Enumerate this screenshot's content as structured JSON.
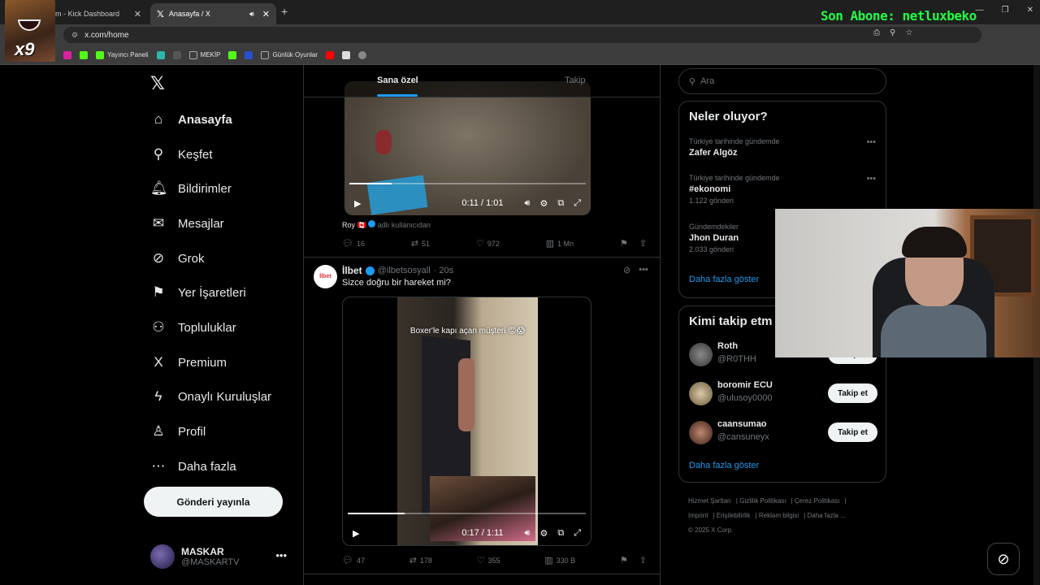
{
  "browser": {
    "tabs": [
      {
        "title": "m - Kick Dashboard",
        "active": false
      },
      {
        "title": "Anasayfa / X",
        "active": true
      }
    ],
    "url": "x.com/home",
    "overlay_text": "Son Abone: netluxbeko",
    "overlay_badge": "x9",
    "bookmarks": [
      {
        "label": "Yayıncı Paneli",
        "color": "#53fc18"
      },
      {
        "label": "MEKİP",
        "color": "#3c3c3c"
      },
      {
        "label": "Günlük Oyunlar",
        "color": "#3c3c3c"
      }
    ]
  },
  "nav": {
    "logo": "X",
    "items": [
      {
        "label": "Anasayfa",
        "icon": "home-icon",
        "glyph": "⌂"
      },
      {
        "label": "Keşfet",
        "icon": "search-icon",
        "glyph": "⚲"
      },
      {
        "label": "Bildirimler",
        "icon": "bell-icon",
        "glyph": "🔔︎"
      },
      {
        "label": "Mesajlar",
        "icon": "mail-icon",
        "glyph": "✉"
      },
      {
        "label": "Grok",
        "icon": "grok-icon",
        "glyph": "⊘"
      },
      {
        "label": "Yer İşaretleri",
        "icon": "bookmark-icon",
        "glyph": "⚑"
      },
      {
        "label": "Topluluklar",
        "icon": "communities-icon",
        "glyph": "⚇"
      },
      {
        "label": "Premium",
        "icon": "x-premium-icon",
        "glyph": "X"
      },
      {
        "label": "Onaylı Kuruluşlar",
        "icon": "lightning-icon",
        "glyph": "ϟ"
      },
      {
        "label": "Profil",
        "icon": "person-icon",
        "glyph": "♙"
      },
      {
        "label": "Daha fazla",
        "icon": "more-circle-icon",
        "glyph": "⋯"
      }
    ],
    "post_button": "Gönderi yayınla",
    "profile": {
      "name": "MASKAR",
      "handle": "@MASKARTV"
    }
  },
  "feed": {
    "tabs": {
      "for_you": "Sana özel",
      "following": "Takip"
    },
    "tweet1": {
      "video_time": "0:11 / 1:01",
      "progress": 0.18,
      "attribution_name": "Roy",
      "attribution_suffix": "adlı kullanıcıdan",
      "replies": "16",
      "reposts": "51",
      "likes": "972",
      "views": "1 Mn"
    },
    "tweet2": {
      "name": "İlbet",
      "handle": "@ilbetsosyall",
      "time": "· 20s",
      "avatar_text": "İlbet",
      "text": "Sizce doğru bir hareket mi?",
      "video_caption": "Boxer'le kapı açan müşteri 😡😱",
      "video_time": "0:17 / 1:11",
      "progress": 0.24,
      "replies": "47",
      "reposts": "178",
      "likes": "355",
      "views": "330 B"
    }
  },
  "right": {
    "search_placeholder": "Ara",
    "trends_title": "Neler oluyor?",
    "trends": [
      {
        "context": "Türkiye tarihinde gündemde",
        "title": "Zafer Algöz",
        "count": ""
      },
      {
        "context": "Türkiye tarihinde gündemde",
        "title": "#ekonomi",
        "count": "1.122 gönderi"
      },
      {
        "context": "Gündemdekiler",
        "title": "Jhon Duran",
        "count": "2.033 gönderi"
      }
    ],
    "show_more": "Daha fazla göster",
    "follow_title": "Kimi takip etm",
    "follow": [
      {
        "name": "Roth",
        "handle": "@R0THH",
        "button": "Takip et"
      },
      {
        "name": "boromir ECU",
        "handle": "@ulusoy0000",
        "button": "Takip et"
      },
      {
        "name": "caansumao",
        "handle": "@cansuneyx",
        "button": "Takip et"
      }
    ],
    "show_more2": "Daha fazla göster",
    "footer": [
      "Hizmet Şartları",
      "Gizlilik Politikası",
      "Çerez Politikası",
      "Imprint",
      "Erişilebilirlik",
      "Reklam bilgisi",
      "Daha fazla ...",
      "© 2025 X Corp."
    ]
  }
}
